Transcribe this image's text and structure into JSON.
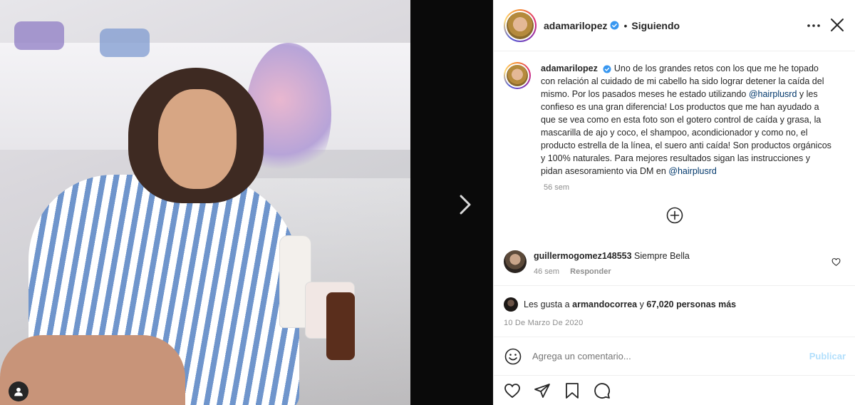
{
  "post": {
    "username": "adamarilopez",
    "follow_state": "Siguiendo",
    "separator": "•",
    "caption_intro": "Uno de los grandes retos con los que me he topado con relación al cuidado de mi cabello ha sido lograr detener la caída del mismo. Por los pasados meses he estado utilizando",
    "mention_1": "@hairplusrd",
    "caption_middle": "y les confieso es una gran diferencia! Los productos que me han ayudado a que se vea como en esta foto son el gotero control de caída y grasa, la mascarilla de ajo y coco, el shampoo, acondicionador y como no, el producto estrella de la línea, el suero anti caída! Son productos orgánicos y 100% naturales. Para mejores resultados sigan las instrucciones y pidan asesoramiento via DM en",
    "mention_2": "@hairplusrd",
    "caption_time": "56 sem",
    "likes_prefix": "Les gusta a",
    "likes_user": "armandocorrea",
    "likes_conjunction": "y",
    "likes_count": "67,020 personas más",
    "date": "10 De Marzo De 2020"
  },
  "comments": [
    {
      "username": "guillermogomez148553",
      "text": "Siempre Bella",
      "time": "46 sem",
      "reply_label": "Responder"
    }
  ],
  "composer": {
    "placeholder": "Agrega un comentario...",
    "publish_label": "Publicar"
  },
  "icons": {
    "verified": "verified-badge-icon",
    "more": "more-options-icon",
    "close": "close-icon",
    "next": "chevron-right-icon",
    "load_more": "plus-circle-icon",
    "heart": "heart-icon",
    "emoji": "emoji-icon",
    "share": "paper-plane-icon",
    "save": "bookmark-icon",
    "comment": "comment-icon",
    "tags": "user-tag-icon"
  },
  "colors": {
    "link": "#00376b",
    "verified": "#3897f0",
    "muted": "#8e8e8e",
    "publish_disabled": "#b2dffc"
  }
}
